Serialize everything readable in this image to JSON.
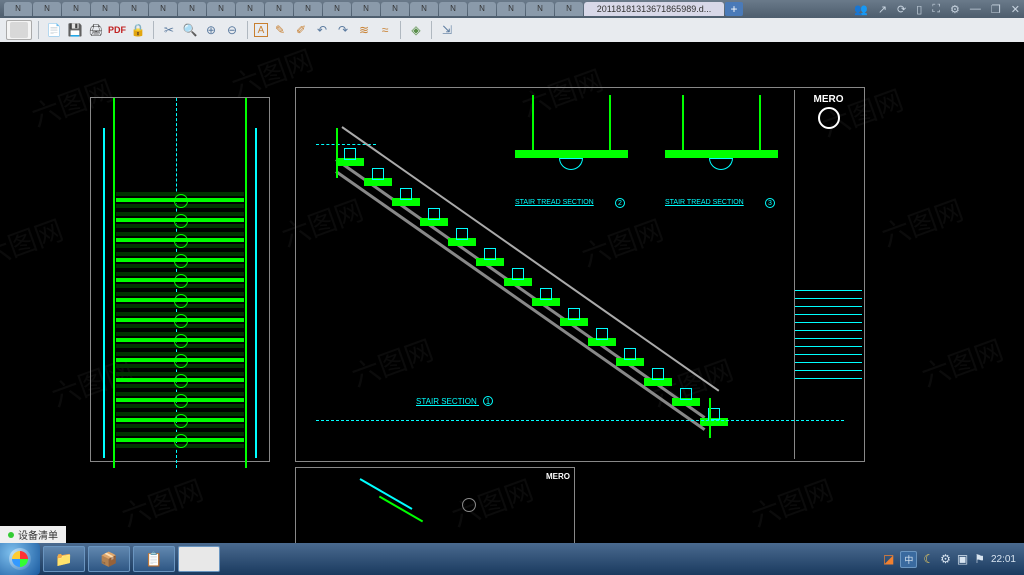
{
  "app": {
    "active_tab": "20118181313671865989.d...",
    "tab_placeholder": "N"
  },
  "title_icons": {
    "people": "people-icon",
    "share": "share-icon",
    "sync": "sync-icon",
    "device": "device-icon",
    "fullscreen": "fullscreen-icon",
    "settings": "settings-icon",
    "minimize": "minimize-icon",
    "restore": "restore-icon",
    "close": "close-icon"
  },
  "toolbar": {
    "new": "new",
    "open": "open",
    "print": "print",
    "pdf": "PDF",
    "lock": "lock"
  },
  "drawing": {
    "main_label": "STAIR SECTION",
    "main_num": "1",
    "detail_a_label": "STAIR TREAD SECTION",
    "detail_a_num": "2",
    "detail_b_label": "STAIR TREAD SECTION",
    "detail_b_num": "3",
    "titleblock_logo": "MERO"
  },
  "status": {
    "label": "设备清单"
  },
  "taskbar": {
    "lang": "中",
    "time": "22:01"
  },
  "watermark": "六图网"
}
